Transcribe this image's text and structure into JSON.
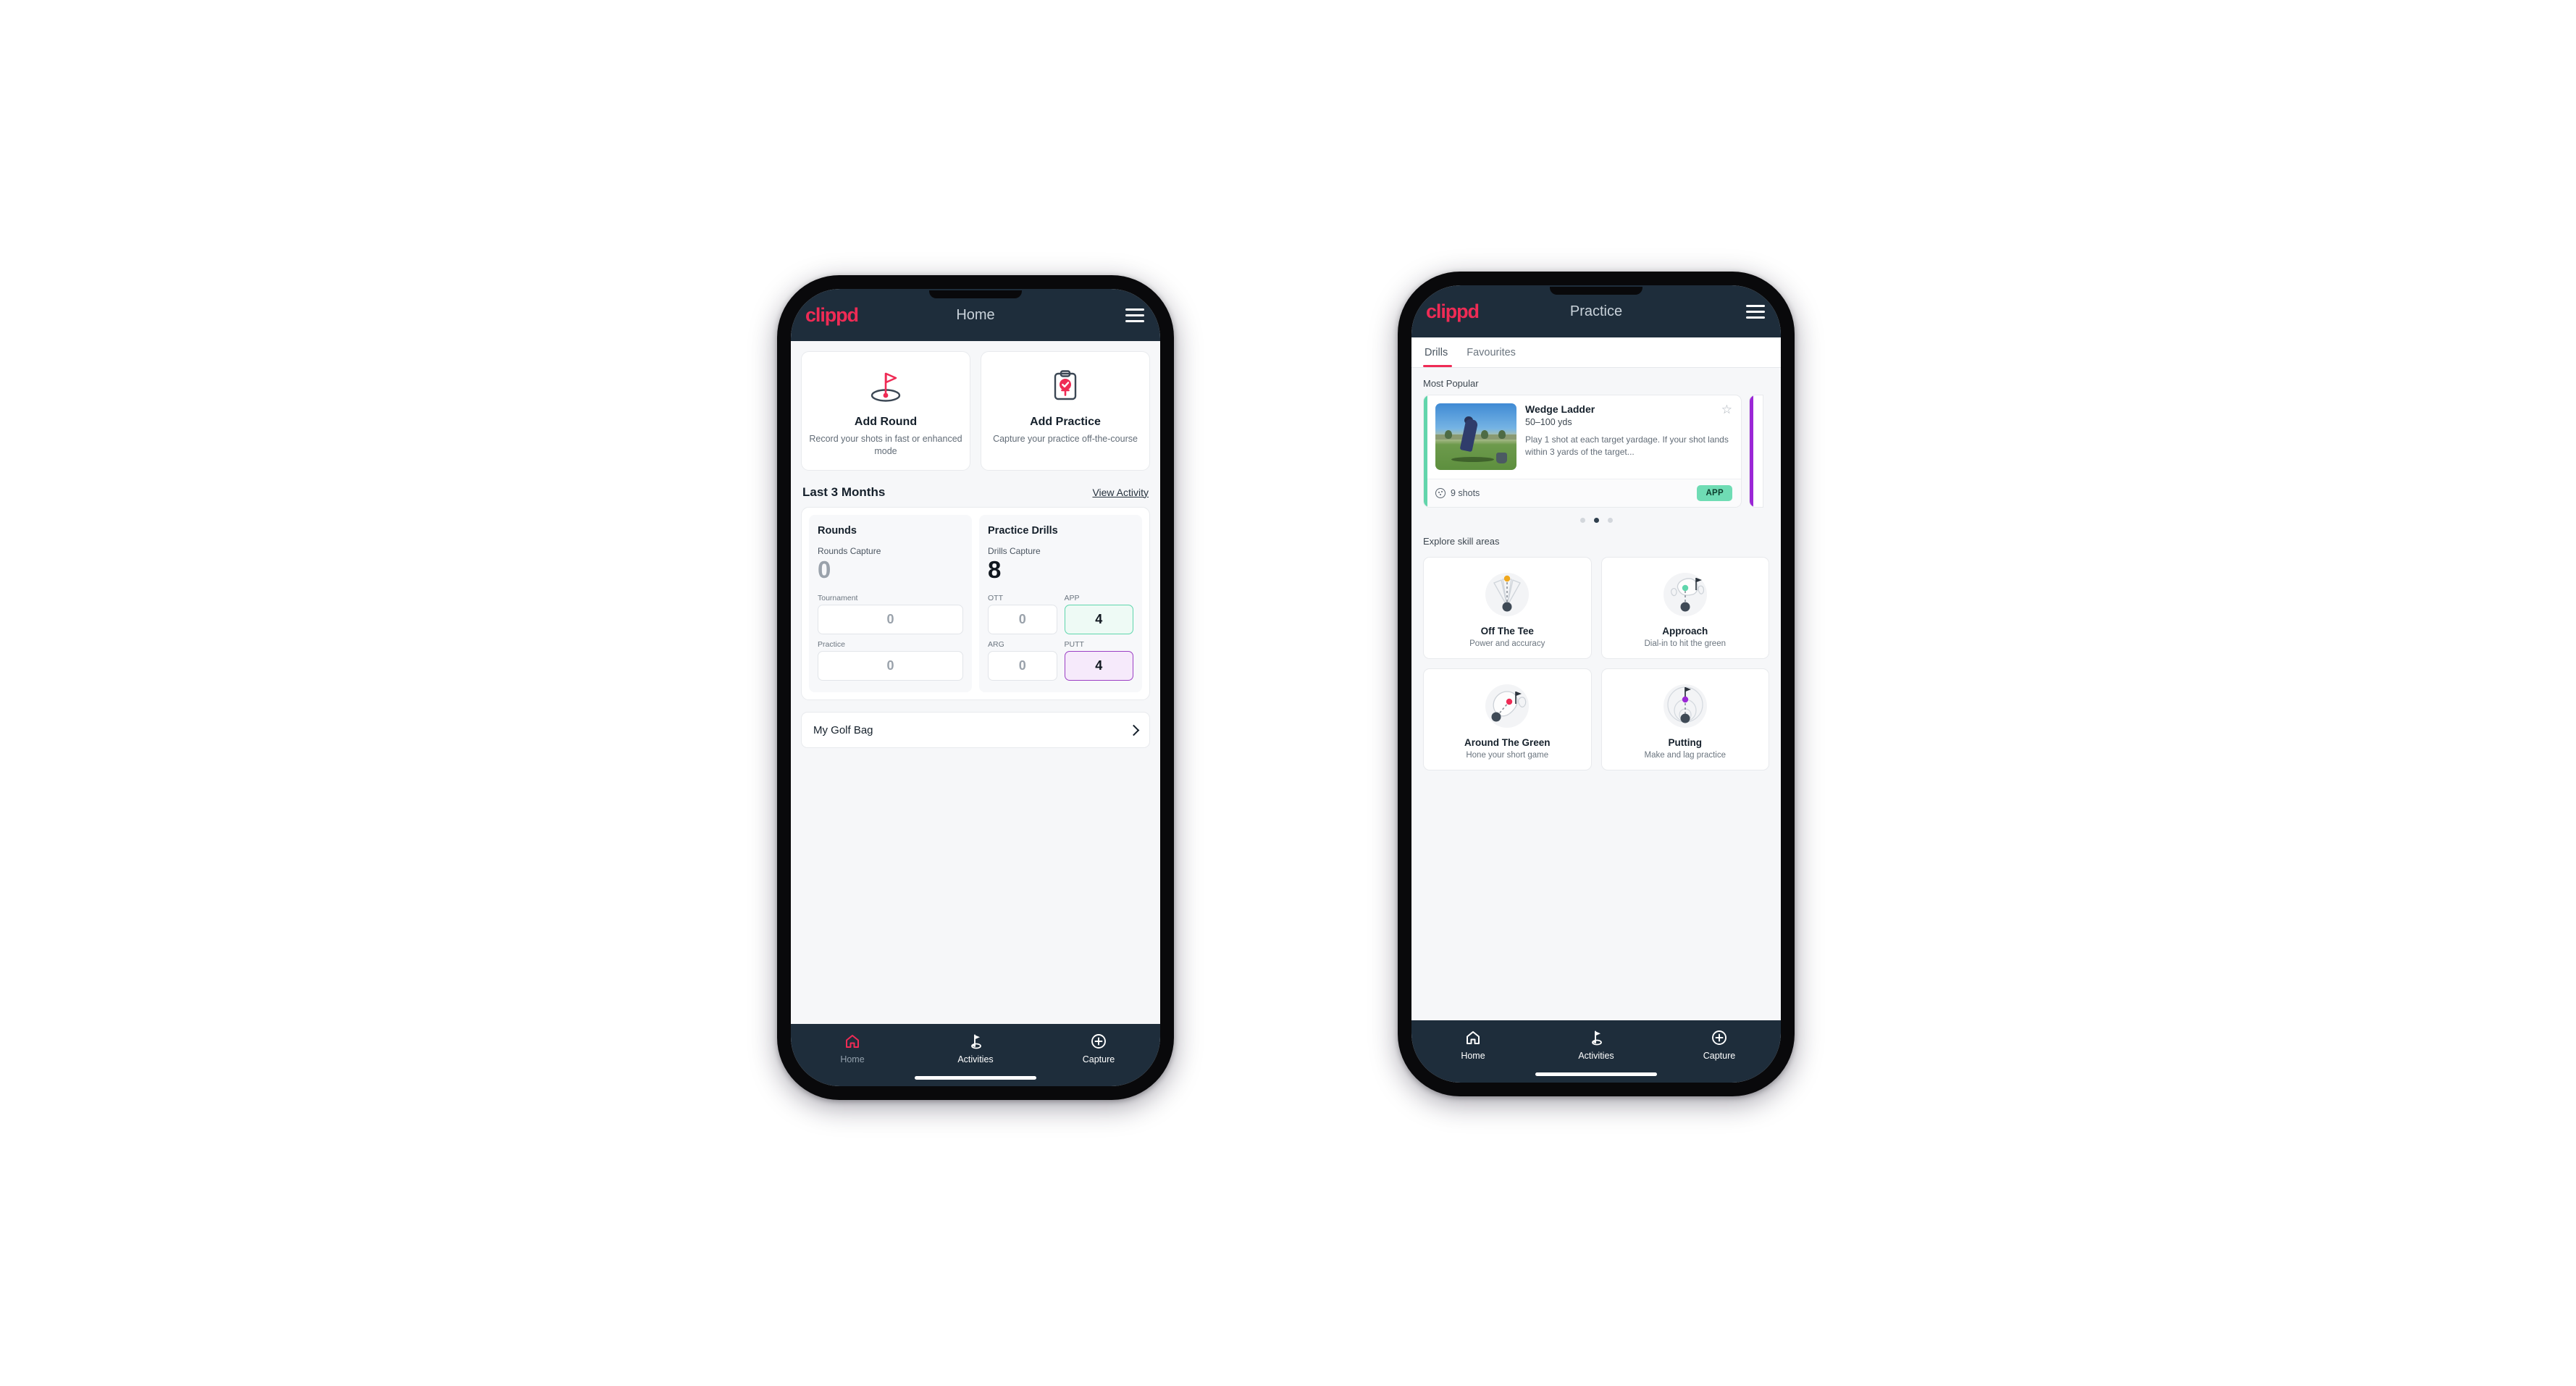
{
  "phone1": {
    "header": {
      "logo": "clippd",
      "title": "Home",
      "menu_icon": "hamburger-icon"
    },
    "quick_actions": [
      {
        "icon": "golf-flag-icon",
        "title": "Add Round",
        "subtitle": "Record your shots in fast or enhanced mode"
      },
      {
        "icon": "clipboard-check-icon",
        "title": "Add Practice",
        "subtitle": "Capture your practice off-the-course"
      }
    ],
    "section": {
      "title": "Last 3 Months",
      "link": "View Activity"
    },
    "rounds": {
      "heading": "Rounds",
      "capture_label": "Rounds Capture",
      "capture_value": "0",
      "minis": [
        {
          "label": "Tournament",
          "value": "0",
          "state": "normal"
        },
        {
          "label": "Practice",
          "value": "0",
          "state": "normal"
        }
      ]
    },
    "drills": {
      "heading": "Practice Drills",
      "capture_label": "Drills Capture",
      "capture_value": "8",
      "minis": [
        {
          "label": "OTT",
          "value": "0",
          "state": "normal"
        },
        {
          "label": "APP",
          "value": "4",
          "state": "app"
        },
        {
          "label": "ARG",
          "value": "0",
          "state": "normal"
        },
        {
          "label": "PUTT",
          "value": "4",
          "state": "putt"
        }
      ]
    },
    "bag_row": {
      "label": "My Golf Bag",
      "chevron": "chevron-right-icon"
    },
    "nav": [
      {
        "icon": "home-icon",
        "label": "Home",
        "active": true
      },
      {
        "icon": "golf-activities-icon",
        "label": "Activities",
        "active": false
      },
      {
        "icon": "plus-circle-icon",
        "label": "Capture",
        "active": false
      }
    ]
  },
  "phone2": {
    "header": {
      "logo": "clippd",
      "title": "Practice",
      "menu_icon": "hamburger-icon"
    },
    "tabs": [
      {
        "label": "Drills",
        "active": true
      },
      {
        "label": "Favourites",
        "active": false
      }
    ],
    "most_popular_label": "Most Popular",
    "drill": {
      "title": "Wedge Ladder",
      "yardage": "50–100 yds",
      "description": "Play 1 shot at each target yardage. If your shot lands within 3 yards of the target...",
      "shots": "9 shots",
      "badge": "APP",
      "favourite_icon": "star-outline-icon",
      "shots_icon": "golf-ball-icon",
      "accent_color": "#62d5ab",
      "next_accent_color": "#9b27d6"
    },
    "carousel_dots": {
      "count": 3,
      "active_index": 1
    },
    "skills_label": "Explore skill areas",
    "skills": [
      {
        "icon": "off-the-tee-icon",
        "name": "Off The Tee",
        "sub": "Power and accuracy",
        "dot_color": "#f0a81e"
      },
      {
        "icon": "approach-icon",
        "name": "Approach",
        "sub": "Dial-in to hit the green",
        "dot_color": "#5fd6ac"
      },
      {
        "icon": "around-the-green-icon",
        "name": "Around The Green",
        "sub": "Hone your short game",
        "dot_color": "#ef2b55"
      },
      {
        "icon": "putting-icon",
        "name": "Putting",
        "sub": "Make and lag practice",
        "dot_color": "#9b27d6"
      }
    ],
    "nav": [
      {
        "icon": "home-icon",
        "label": "Home",
        "active": false
      },
      {
        "icon": "golf-activities-icon",
        "label": "Activities",
        "active": false
      },
      {
        "icon": "plus-circle-icon",
        "label": "Capture",
        "active": false
      }
    ]
  },
  "theme": {
    "brand_pink": "#ef2b55",
    "header_navy": "#1e2d3b",
    "app_bg": "#f6f7f9",
    "teal": "#5fd6ac",
    "purple": "#9b3fc4"
  }
}
